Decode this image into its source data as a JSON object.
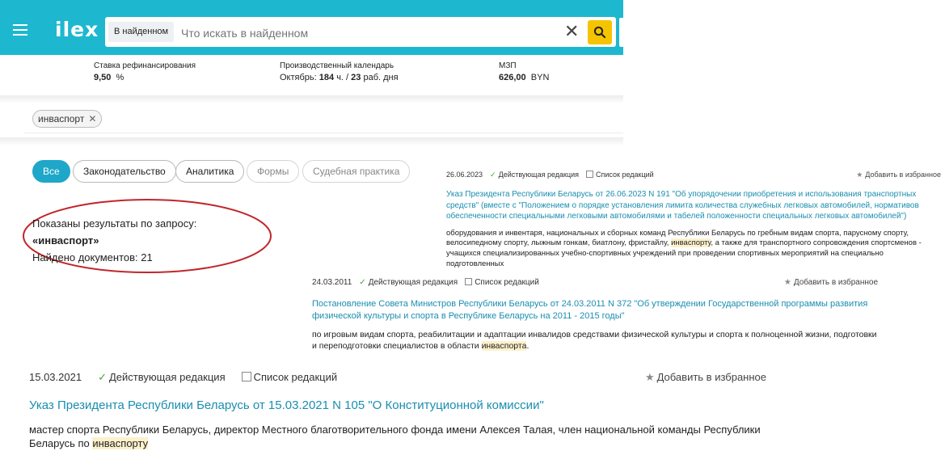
{
  "header": {
    "logo": "ilex",
    "scope_label": "В найденном",
    "search_placeholder": "Что искать в найденном",
    "clear_glyph": "✕"
  },
  "info": {
    "rate": {
      "label": "Ставка рефинансирования",
      "value": "9,50",
      "unit": "%"
    },
    "calendar": {
      "label": "Производственный календарь",
      "month": "Октябрь:",
      "hours": "184",
      "hours_unit": "ч. /",
      "days": "23",
      "days_unit": "раб. дня"
    },
    "mzp": {
      "label": "МЗП",
      "value": "626,00",
      "unit": "BYN"
    }
  },
  "query_chip": {
    "label": "инваспорт",
    "remove_glyph": "✕"
  },
  "tabs": [
    {
      "label": "Все"
    },
    {
      "label": "Законодательство"
    },
    {
      "label": "Аналитика"
    },
    {
      "label": "Формы"
    },
    {
      "label": "Судебная практика"
    }
  ],
  "summary": {
    "line1": "Показаны результаты по запросу:",
    "query": "«инваспорт»",
    "count": "Найдено документов: 21"
  },
  "results": [
    {
      "date": "26.06.2023",
      "status": "Действующая редакция",
      "versions": "Список редакций",
      "favorite": "Добавить в избранное",
      "title": "Указ Президента Республики Беларусь от 26.06.2023 N 191 \"Об упорядочении приобретения и использования транспортных средств\" (вместе с \"Положением о порядке установления лимита количества служебных легковых автомобилей, нормативов обеспеченности специальными легковыми автомобилями и табелей положенности специальных легковых автомобилей\")",
      "snippet_before": "оборудования и инвентаря, национальных и сборных команд Республики Беларусь по гребным видам спорта, парусному спорту, велосипедному спорту, лыжным гонкам, биатлону, фристайлу, ",
      "snippet_hl": "инваспорту",
      "snippet_after": ", а также для транспортного сопровождения спортсменов - учащихся специализированных учебно-спортивных учреждений при проведении спортивных мероприятий на специально подготовленных"
    },
    {
      "date": "24.03.2011",
      "status": "Действующая редакция",
      "versions": "Список редакций",
      "favorite": "Добавить в избранное",
      "title": "Постановление Совета Министров Республики Беларусь от 24.03.2011 N 372 \"Об утверждении Государственной программы развития физической культуры и спорта в Республике Беларусь на 2011 - 2015 годы\"",
      "snippet_before": "по игровым видам спорта, реабилитации и адаптации инвалидов средствами физической культуры и спорта к полноценной жизни, подготовки и переподготовки специалистов в области ",
      "snippet_hl": "инваспорта",
      "snippet_after": "."
    },
    {
      "date": "15.03.2021",
      "status": "Действующая редакция",
      "versions": "Список редакций",
      "favorite": "Добавить в избранное",
      "title": "Указ Президента Республики Беларусь от 15.03.2021 N 105 \"О Конституционной комиссии\"",
      "snippet_before": "мастер спорта Республики Беларусь, директор Местного благотворительного фонда имени Алексея Талая, член национальной команды Республики Беларусь по ",
      "snippet_hl": "инваспорту",
      "snippet_after": ""
    }
  ],
  "colors": {
    "topbar": "#1db8cf",
    "accent": "#1ea7c8",
    "search_button": "#f5c400",
    "link": "#1a8eb0",
    "highlight": "#fdf1cc",
    "annotation": "#c0262a"
  }
}
